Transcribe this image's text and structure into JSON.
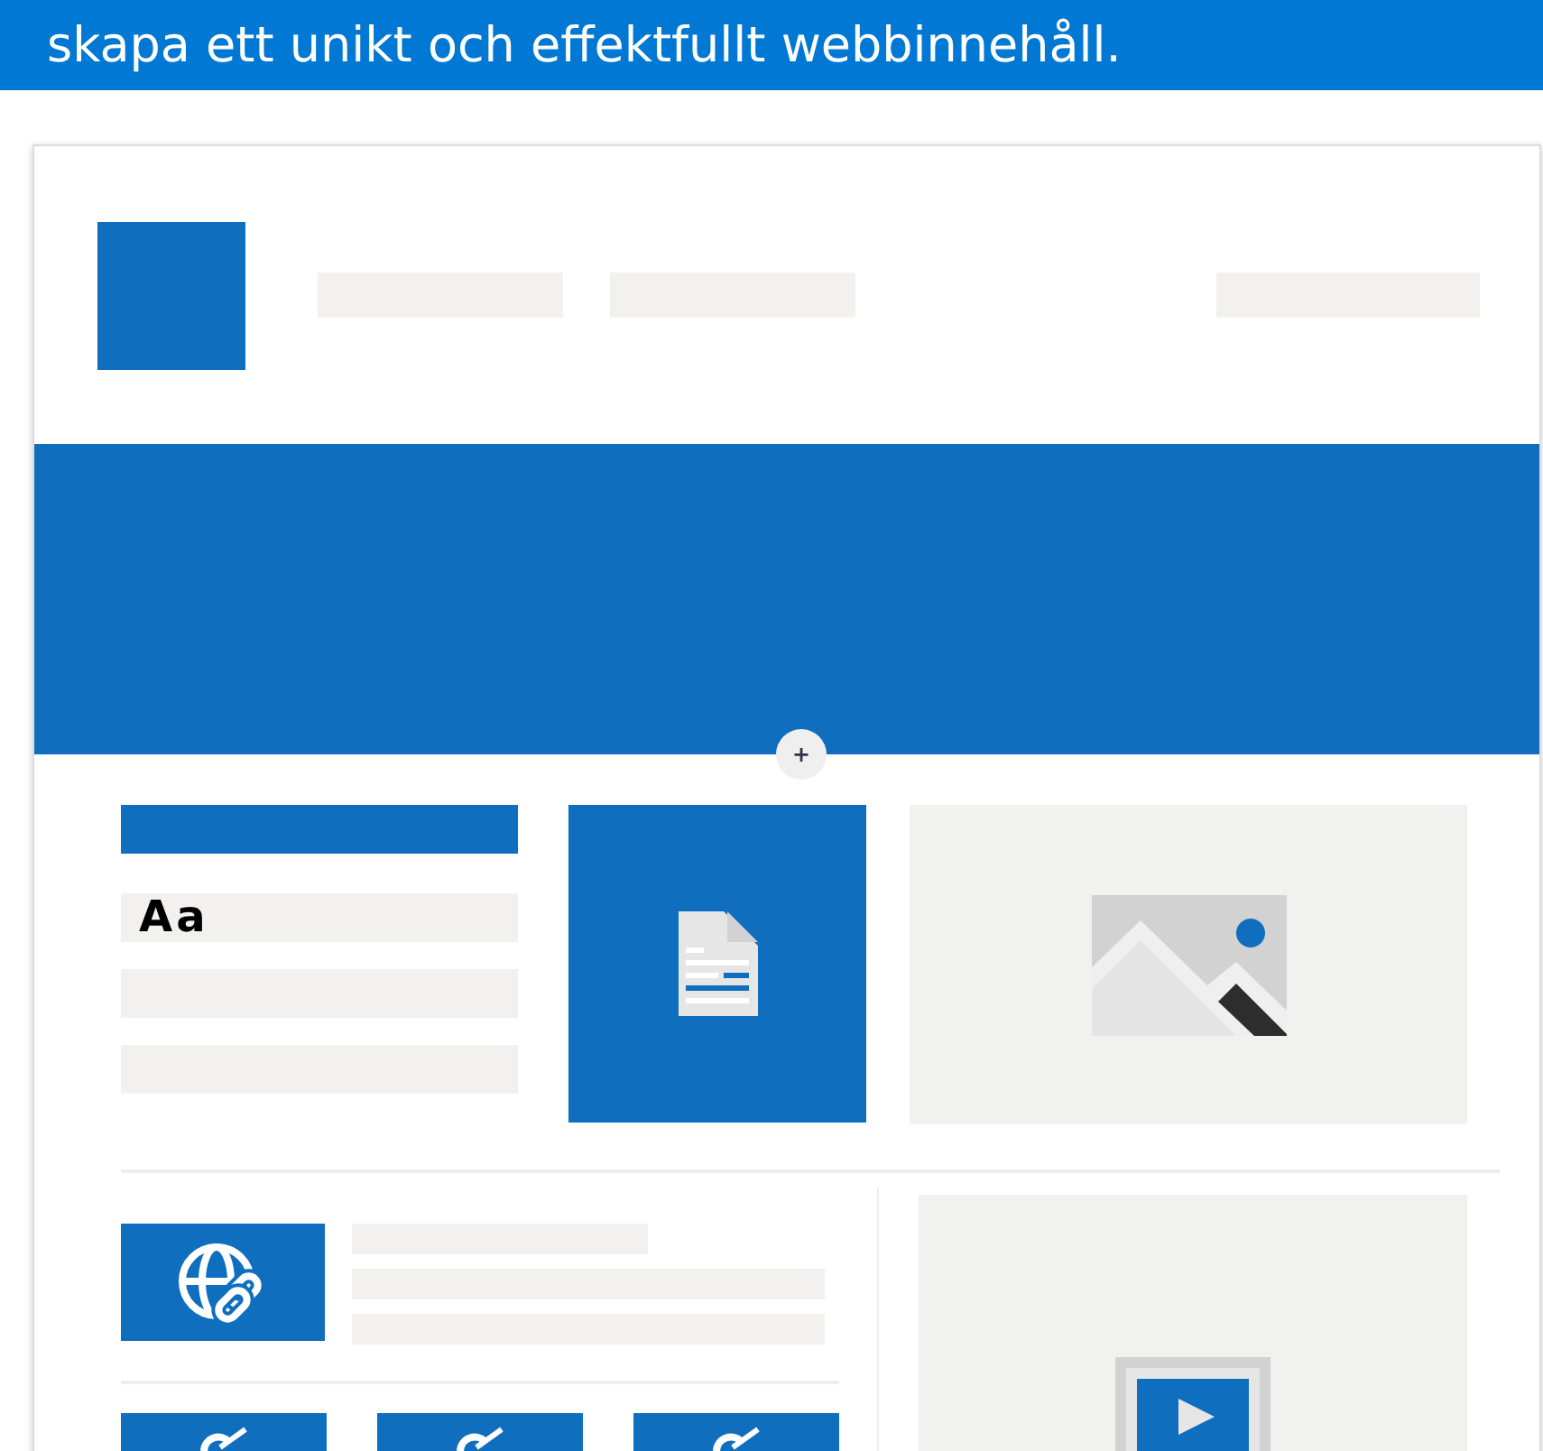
{
  "banner": {
    "text": "skapa ett unikt och effektfullt webbinnehåll."
  },
  "hero": {
    "add_button": "+"
  },
  "text_block": {
    "sample": "Aa"
  }
}
